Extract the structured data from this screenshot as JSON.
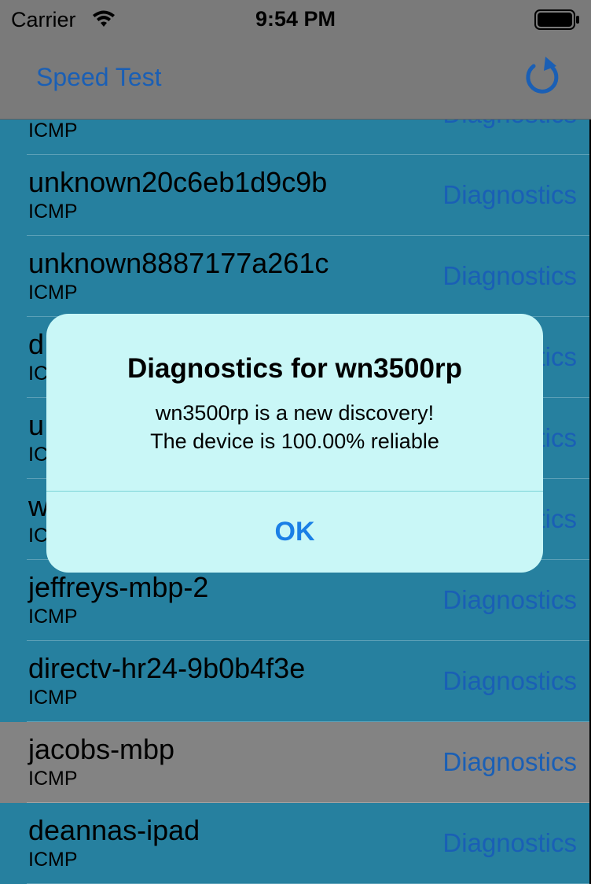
{
  "status_bar": {
    "carrier": "Carrier",
    "time": "9:54 PM"
  },
  "nav_bar": {
    "back_label": "Speed Test",
    "refresh_icon": "refresh-icon"
  },
  "colors": {
    "accent": "#1a5fb5",
    "row_bg": "#26809f",
    "selected_row_bg": "#838383",
    "alert_bg": "#c9f7f7"
  },
  "rows": [
    {
      "name": "",
      "protocol": "ICMP",
      "action": "Diagnostics"
    },
    {
      "name": "unknown20c6eb1d9c9b",
      "protocol": "ICMP",
      "action": "Diagnostics"
    },
    {
      "name": "unknown8887177a261c",
      "protocol": "ICMP",
      "action": "Diagnostics"
    },
    {
      "name": "d",
      "protocol": "IC",
      "action": "Diagnostics"
    },
    {
      "name": "u",
      "protocol": "IC",
      "action": "Diagnostics"
    },
    {
      "name": "w",
      "protocol": "IC",
      "action": "Diagnostics"
    },
    {
      "name": "jeffreys-mbp-2",
      "protocol": "ICMP",
      "action": "Diagnostics"
    },
    {
      "name": "directv-hr24-9b0b4f3e",
      "protocol": "ICMP",
      "action": "Diagnostics"
    },
    {
      "name": "jacobs-mbp",
      "protocol": "ICMP",
      "action": "Diagnostics",
      "selected": true
    },
    {
      "name": "deannas-ipad",
      "protocol": "ICMP",
      "action": "Diagnostics"
    }
  ],
  "alert": {
    "title": "Diagnostics for wn3500rp",
    "message_line1": "wn3500rp is a new discovery!",
    "message_line2": "The device is 100.00% reliable",
    "ok_label": "OK"
  }
}
